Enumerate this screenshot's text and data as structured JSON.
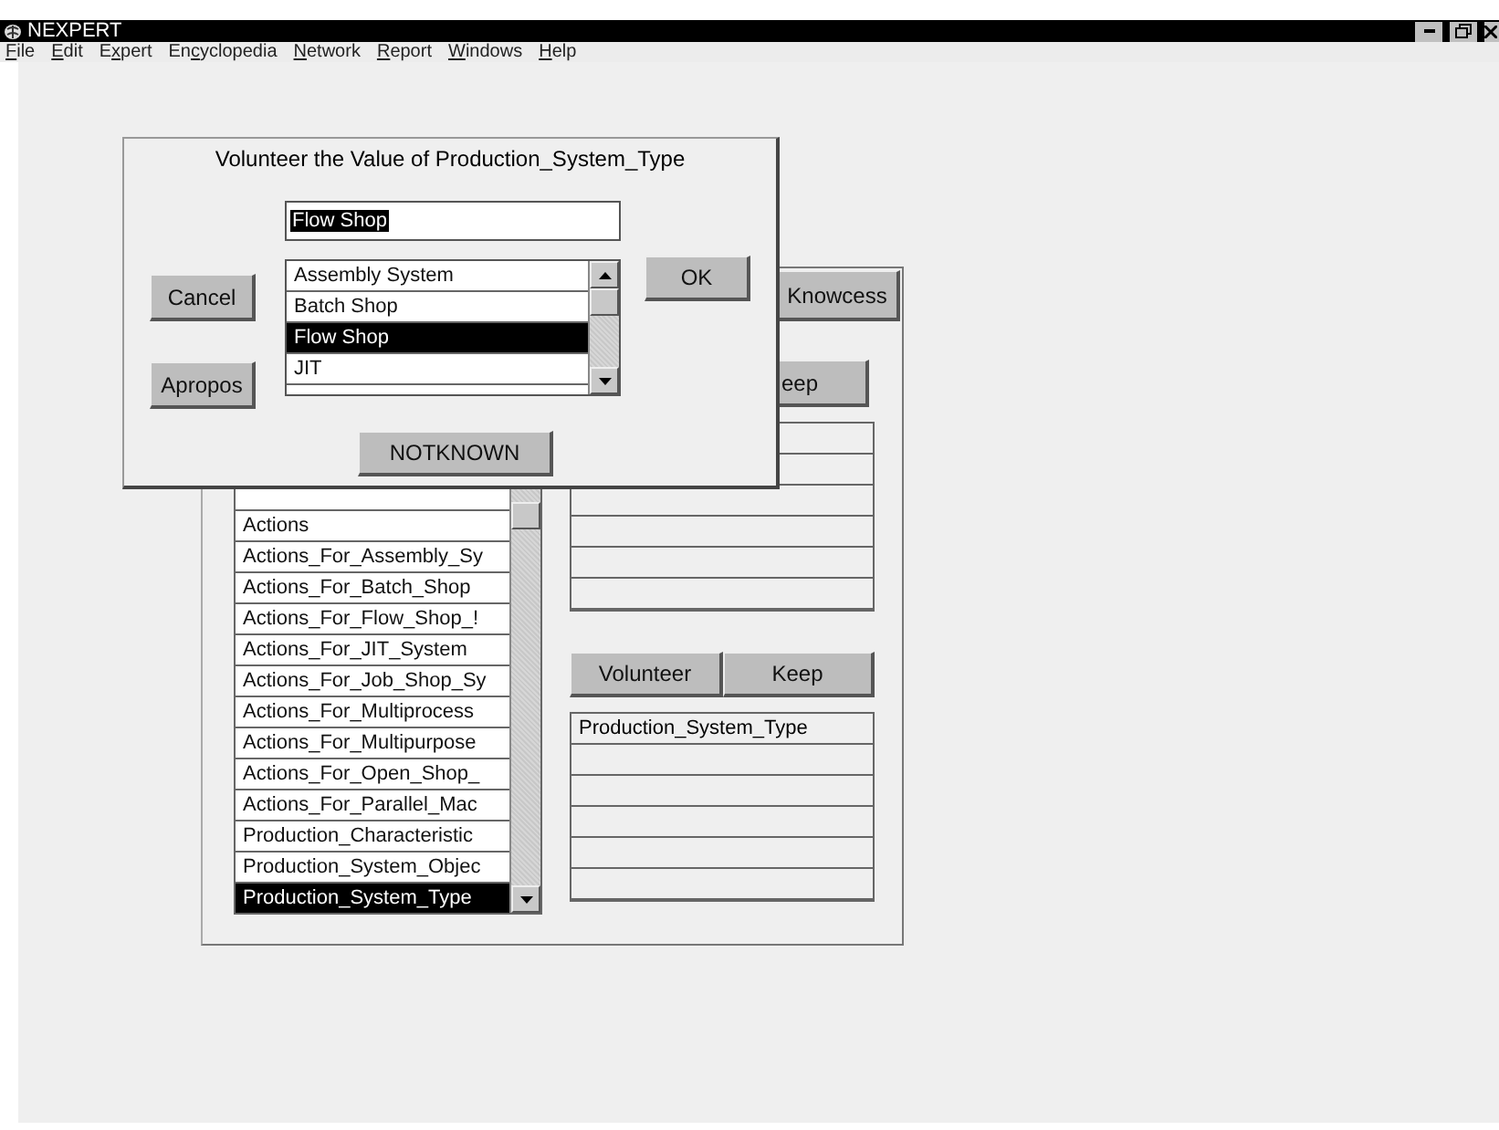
{
  "window": {
    "title": "NEXPERT"
  },
  "menu": [
    {
      "key": "F",
      "after": "ile"
    },
    {
      "key": "E",
      "after": "dit"
    },
    {
      "before": "E",
      "key": "x",
      "after": "pert"
    },
    {
      "before": "En",
      "key": "c",
      "after": "yclopedia"
    },
    {
      "key": "N",
      "after": "etwork"
    },
    {
      "key": "R",
      "after": "eport"
    },
    {
      "key": "W",
      "after": "indows"
    },
    {
      "key": "H",
      "after": "elp"
    }
  ],
  "back_panel": {
    "top_button": "Knowcess",
    "keep_button_partial": "eep",
    "list": [
      {
        "label": "Actions",
        "selected": false
      },
      {
        "label": "Actions_For_Assembly_Sy",
        "selected": false
      },
      {
        "label": "Actions_For_Batch_Shop",
        "selected": false
      },
      {
        "label": "Actions_For_Flow_Shop_!",
        "selected": false
      },
      {
        "label": "Actions_For_JIT_System",
        "selected": false
      },
      {
        "label": "Actions_For_Job_Shop_Sy",
        "selected": false
      },
      {
        "label": "Actions_For_Multiprocess",
        "selected": false
      },
      {
        "label": "Actions_For_Multipurpose",
        "selected": false
      },
      {
        "label": "Actions_For_Open_Shop_",
        "selected": false
      },
      {
        "label": "Actions_For_Parallel_Mac",
        "selected": false
      },
      {
        "label": "Production_Characteristic",
        "selected": false
      },
      {
        "label": "Production_System_Objec",
        "selected": false
      },
      {
        "label": "Production_System_Type",
        "selected": true
      }
    ],
    "buttons": [
      "Volunteer",
      "Keep"
    ],
    "value_table": [
      "Production_System_Type"
    ]
  },
  "dialog": {
    "title": "Volunteer the Value of Production_System_Type",
    "field": {
      "value": "Flow Shop",
      "highlighted": true
    },
    "options": [
      {
        "label": "Assembly System",
        "selected": false
      },
      {
        "label": "Batch Shop",
        "selected": false
      },
      {
        "label": "Flow Shop",
        "selected": true
      },
      {
        "label": "JIT",
        "selected": false
      }
    ],
    "left_buttons": [
      "Cancel",
      "Apropos"
    ],
    "ok": "OK",
    "notknown": "NOTKNOWN"
  }
}
